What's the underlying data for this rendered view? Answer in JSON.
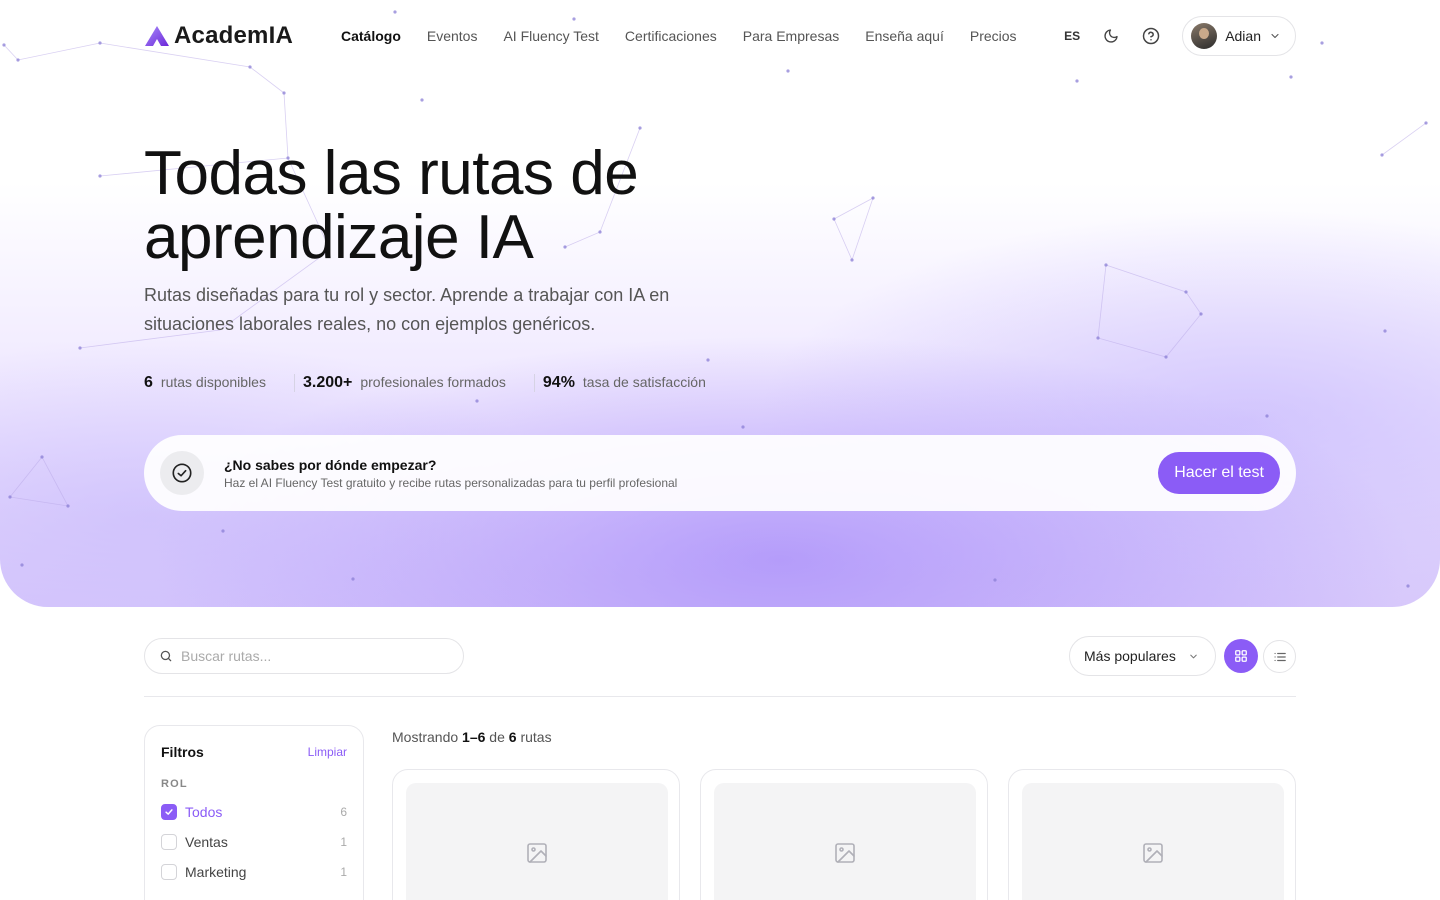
{
  "brand": {
    "name": "AcademIA",
    "accent": "#8b5cf6"
  },
  "nav": {
    "items": [
      {
        "label": "Catálogo",
        "active": true
      },
      {
        "label": "Eventos"
      },
      {
        "label": "AI Fluency Test"
      },
      {
        "label": "Certificaciones"
      },
      {
        "label": "Para Empresas"
      },
      {
        "label": "Enseña aquí"
      },
      {
        "label": "Precios"
      }
    ],
    "language": "ES",
    "user": {
      "name": "Adian"
    }
  },
  "hero": {
    "title": "Todas las rutas de aprendizaje IA",
    "subtitle": "Rutas diseñadas para tu rol y sector. Aprende a trabajar con IA en situaciones laborales reales, no con ejemplos genéricos.",
    "stats": [
      {
        "value": "6",
        "label": "rutas disponibles"
      },
      {
        "value": "3.200+",
        "label": "profesionales formados"
      },
      {
        "value": "94%",
        "label": "tasa de satisfacción"
      }
    ]
  },
  "cta": {
    "title": "¿No sabes por dónde empezar?",
    "description": "Haz el AI Fluency Test gratuito y recibe rutas personalizadas para tu perfil profesional",
    "button": "Hacer el test"
  },
  "toolbar": {
    "search_placeholder": "Buscar rutas...",
    "sort_label": "Más populares"
  },
  "filters": {
    "title": "Filtros",
    "clear": "Limpiar",
    "group": "ROL",
    "options": [
      {
        "label": "Todos",
        "count": "6",
        "checked": true
      },
      {
        "label": "Ventas",
        "count": "1",
        "checked": false
      },
      {
        "label": "Marketing",
        "count": "1",
        "checked": false
      }
    ]
  },
  "results": {
    "prefix": "Mostrando",
    "range": "1–6",
    "of": "de",
    "total": "6",
    "suffix": "rutas"
  }
}
